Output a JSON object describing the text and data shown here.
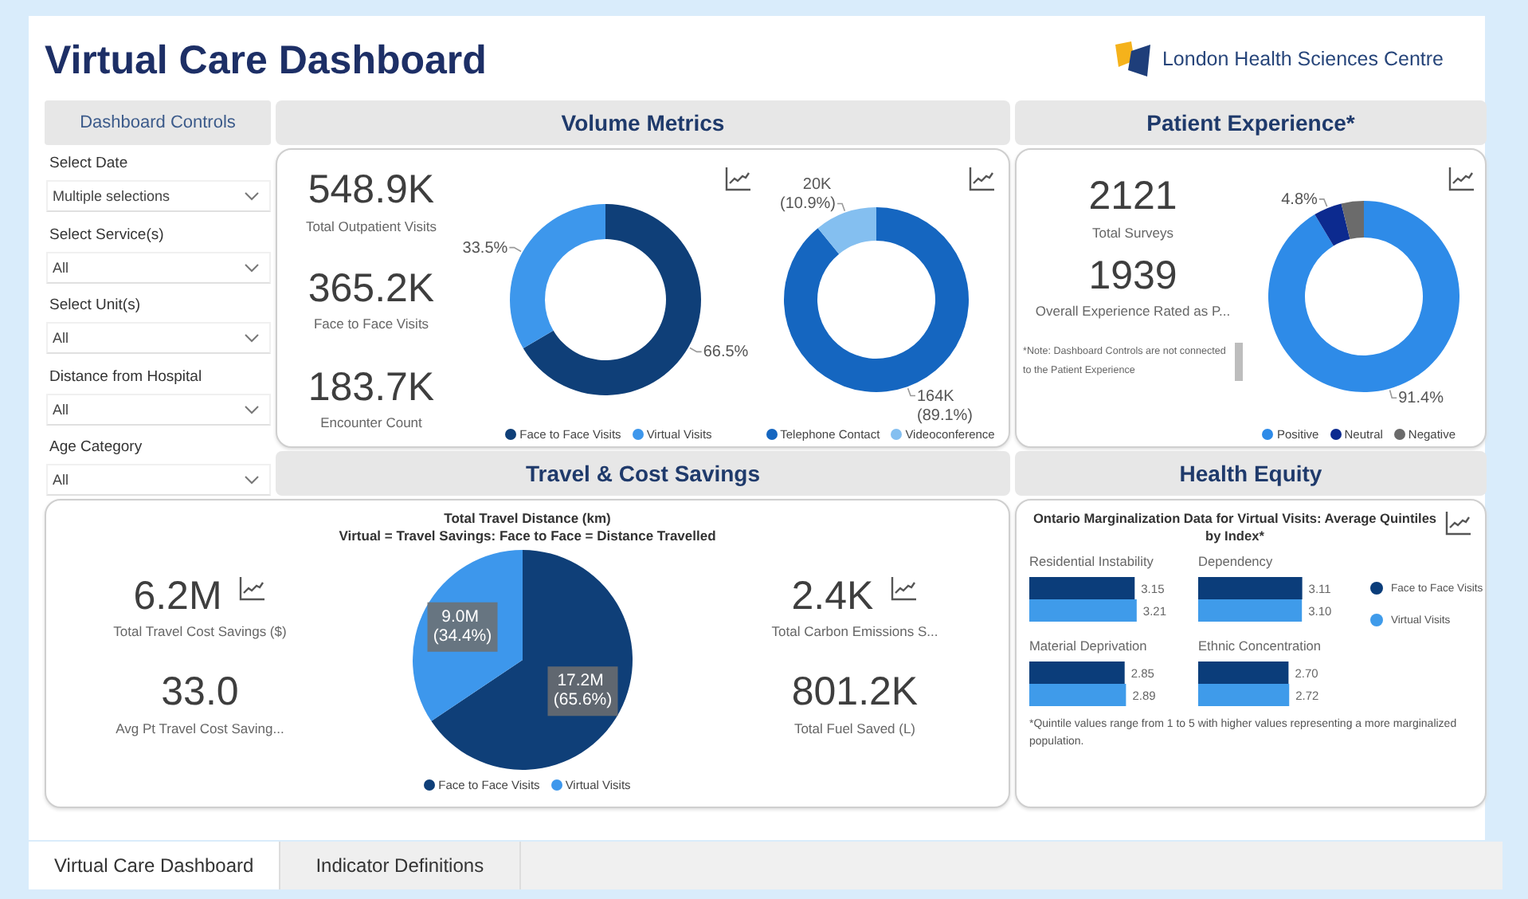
{
  "header": {
    "title": "Virtual Care Dashboard",
    "logo_text": "London Health Sciences Centre"
  },
  "controls": {
    "title": "Dashboard Controls",
    "filters": [
      {
        "label": "Select Date",
        "value": "Multiple selections"
      },
      {
        "label": "Select Service(s)",
        "value": "All"
      },
      {
        "label": "Select Unit(s)",
        "value": "All"
      },
      {
        "label": "Distance from Hospital",
        "value": "All"
      },
      {
        "label": "Age Category",
        "value": "All"
      }
    ]
  },
  "volume_metrics": {
    "title": "Volume Metrics",
    "kpis": [
      {
        "value": "548.9K",
        "label": "Total Outpatient Visits"
      },
      {
        "value": "365.2K",
        "label": "Face to Face Visits"
      },
      {
        "value": "183.7K",
        "label": "Encounter Count"
      }
    ],
    "charts": [
      {
        "legend": [
          {
            "color": "#0f3f78"
          },
          {
            "color": "#3d97ec"
          }
        ],
        "chart_data": {
          "type": "donut",
          "categories": [
            "Face to Face Visits",
            "Virtual Visits"
          ],
          "values": [
            66.5,
            33.5
          ],
          "value_labels": [
            "66.5%",
            "33.5%"
          ]
        }
      },
      {
        "legend": [
          {
            "color": "#1566c0"
          },
          {
            "color": "#84bff0"
          }
        ],
        "chart_data": {
          "type": "donut",
          "categories": [
            "Telephone Contact",
            "Videoconference"
          ],
          "values": [
            89.1,
            10.9
          ],
          "value_labels": [
            "164K (89.1%)",
            "20K (10.9%)"
          ]
        }
      }
    ]
  },
  "patient_experience": {
    "title": "Patient Experience*",
    "kpis": [
      {
        "value": "2121",
        "label": "Total Surveys"
      },
      {
        "value": "1939",
        "label": "Overall Experience Rated as P..."
      }
    ],
    "note": "*Note: Dashboard Controls are not connected to the Patient Experience",
    "legend": [
      {
        "color": "#2e8be8"
      },
      {
        "color": "#0c2a8f"
      },
      {
        "color": "#6b6b6b"
      }
    ],
    "chart_data": {
      "type": "donut",
      "categories": [
        "Positive",
        "Neutral",
        "Negative"
      ],
      "values": [
        91.4,
        4.8,
        3.8
      ],
      "value_labels": [
        "91.4%",
        "4.8%",
        null
      ]
    }
  },
  "travel": {
    "title": "Travel & Cost Savings",
    "kpis_left": [
      {
        "value": "6.2M",
        "label": "Total Travel Cost Savings ($)"
      },
      {
        "value": "33.0",
        "label": "Avg Pt Travel Cost Saving..."
      }
    ],
    "kpis_right": [
      {
        "value": "2.4K",
        "label": "Total Carbon Emissions S..."
      },
      {
        "value": "801.2K",
        "label": "Total Fuel Saved (L)"
      }
    ],
    "chart_subtitle": "Virtual = Travel Savings: Face to Face = Distance Travelled",
    "legend": [
      {
        "color": "#0f3f78"
      },
      {
        "color": "#3d97ec"
      }
    ],
    "chart_data": {
      "type": "pie",
      "title": "Total Travel Distance (km)",
      "categories": [
        "Face to Face Visits",
        "Virtual Visits"
      ],
      "values": [
        65.6,
        34.4
      ],
      "value_labels": [
        "17.2M (65.6%)",
        "9.0M (34.4%)"
      ]
    }
  },
  "health_equity": {
    "title": "Health Equity",
    "chart_title": "Ontario Marginalization Data for Virtual Visits: Average Quintiles by Index*",
    "legend": [
      {
        "label": "Face to Face Visits"
      },
      {
        "label": "Virtual Visits"
      }
    ],
    "charts": [
      {
        "chart_data": {
          "type": "bar",
          "orientation": "horizontal",
          "title": "Residential Instability",
          "categories": [
            null
          ],
          "series": [
            {
              "color": "#0b3d7a",
              "values": [
                3.15
              ],
              "value_labels": [
                "3.15"
              ]
            },
            {
              "color": "#3f9bea",
              "values": [
                3.21
              ],
              "value_labels": [
                "3.21"
              ]
            }
          ]
        }
      },
      {
        "chart_data": {
          "type": "bar",
          "orientation": "horizontal",
          "title": "Dependency",
          "categories": [
            null
          ],
          "series": [
            {
              "color": "#0b3d7a",
              "values": [
                3.11
              ],
              "value_labels": [
                "3.11"
              ]
            },
            {
              "color": "#3f9bea",
              "values": [
                3.1
              ],
              "value_labels": [
                "3.10"
              ]
            }
          ]
        }
      },
      {
        "chart_data": {
          "type": "bar",
          "orientation": "horizontal",
          "title": "Material Deprivation",
          "categories": [
            null
          ],
          "series": [
            {
              "color": "#0b3d7a",
              "values": [
                2.85
              ],
              "value_labels": [
                "2.85"
              ]
            },
            {
              "color": "#3f9bea",
              "values": [
                2.89
              ],
              "value_labels": [
                "2.89"
              ]
            }
          ]
        }
      },
      {
        "chart_data": {
          "type": "bar",
          "orientation": "horizontal",
          "title": "Ethnic Concentration",
          "categories": [
            null
          ],
          "series": [
            {
              "color": "#0b3d7a",
              "values": [
                2.7
              ],
              "value_labels": [
                "2.70"
              ]
            },
            {
              "color": "#3f9bea",
              "values": [
                2.72
              ],
              "value_labels": [
                "2.72"
              ]
            }
          ]
        }
      }
    ],
    "footnote": "*Quintile values range from 1 to 5 with higher values representing a more marginalized population."
  },
  "tabs": [
    {
      "label": "Virtual Care Dashboard",
      "selected": true
    },
    {
      "label": "Indicator Definitions",
      "selected": false
    }
  ]
}
